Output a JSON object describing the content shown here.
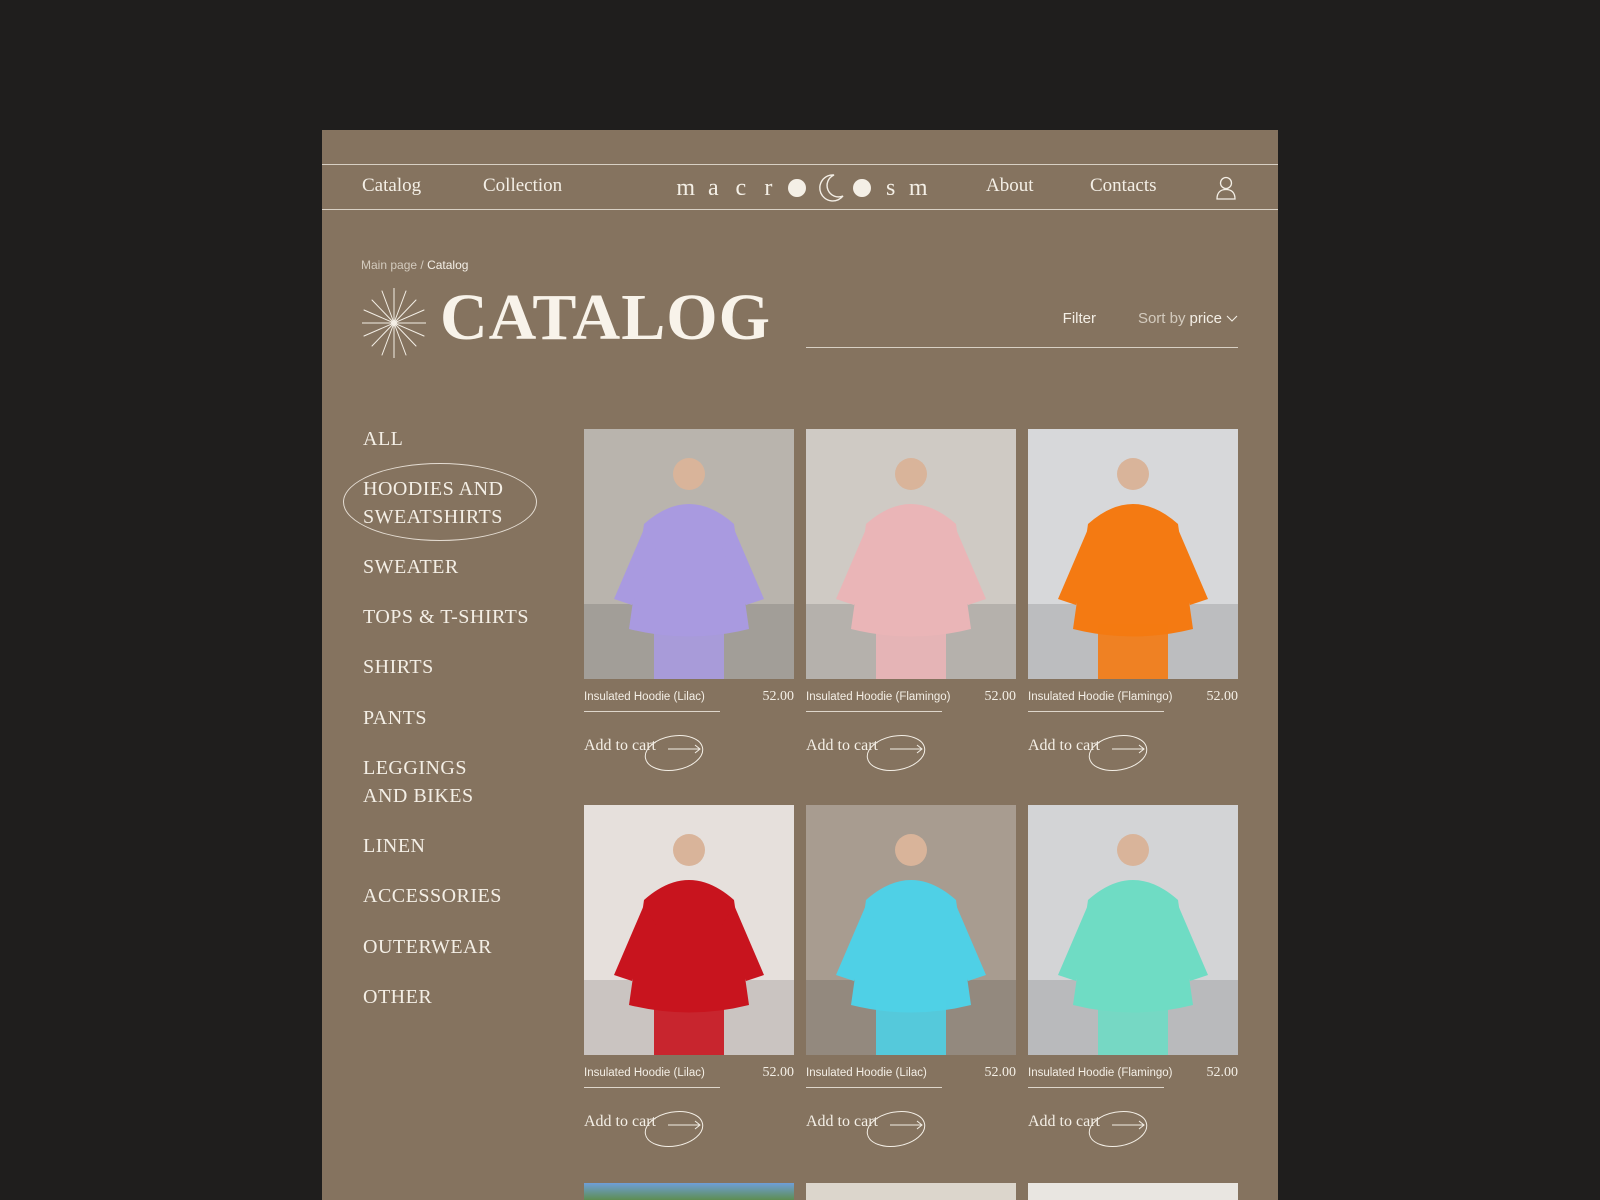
{
  "nav": {
    "left": [
      "Catalog",
      "Collection"
    ],
    "right": [
      "About",
      "Contacts"
    ],
    "logo_letters_left": [
      "m",
      "a",
      "c",
      "r"
    ],
    "logo_letters_right": [
      "s",
      "m"
    ]
  },
  "breadcrumb": {
    "home": "Main page",
    "sep": " / ",
    "current": "Catalog"
  },
  "title": "CATALOG",
  "toolbar": {
    "filter": "Filter",
    "sort_prefix": "Sort by",
    "sort_value": "price"
  },
  "categories": [
    "ALL",
    "HOODIES AND",
    "SWEATSHIRTS",
    "SWEATER",
    "TOPS & T-SHIRTS",
    "SHIRTS",
    "PANTS",
    "LEGGINGS",
    "AND BIKES",
    "LINEN",
    "ACCESSORIES",
    "OUTERWEAR",
    "OTHER"
  ],
  "selected_category": "HOODIES AND SWEATSHIRTS",
  "products": [
    {
      "name": "Insulated Hoodie (Lilac)",
      "price": "52.00",
      "cart": "Add to cart",
      "color": "#a99ae0",
      "bg": "#b9b4ad"
    },
    {
      "name": "Insulated Hoodie (Flamingo)",
      "price": "52.00",
      "cart": "Add to cart",
      "color": "#eab5b7",
      "bg": "#cfcac4"
    },
    {
      "name": "Insulated Hoodie (Flamingo)",
      "price": "52.00",
      "cart": "Add to cart",
      "color": "#f47a12",
      "bg": "#d7d8da"
    },
    {
      "name": "Insulated Hoodie (Lilac)",
      "price": "52.00",
      "cart": "Add to cart",
      "color": "#c8141e",
      "bg": "#e6e0dc"
    },
    {
      "name": "Insulated Hoodie (Lilac)",
      "price": "52.00",
      "cart": "Add to cart",
      "color": "#4fd0e6",
      "bg": "#a89c90"
    },
    {
      "name": "Insulated Hoodie (Flamingo)",
      "price": "52.00",
      "cart": "Add to cart",
      "color": "#6fdcc4",
      "bg": "#d3d4d6"
    }
  ],
  "colors": {
    "panel": "#85735f",
    "page_bg": "#1f1e1d",
    "text": "#f4efe6"
  }
}
